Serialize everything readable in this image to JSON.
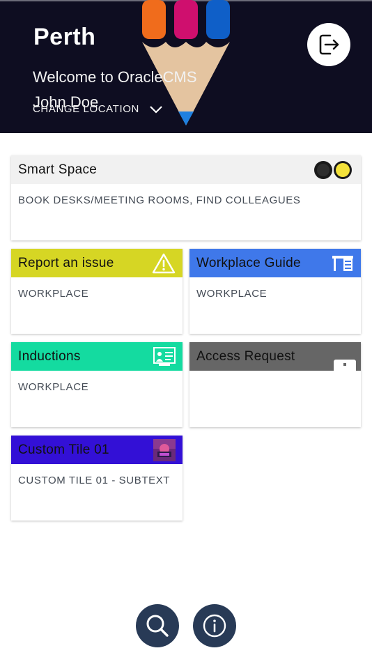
{
  "header": {
    "city": "Perth",
    "welcome": "Welcome to OracleCMS",
    "user": "John Doe",
    "change_location": "CHANGE LOCATION"
  },
  "tiles": [
    {
      "title": "Smart Space",
      "subtitle": "BOOK DESKS/MEETING ROOMS, FIND COLLEAGUES",
      "color": "#f1f1f1",
      "icon": "toggle-icon"
    },
    {
      "title": "Report an issue",
      "subtitle": "WORKPLACE",
      "color": "#d6d624",
      "icon": "warning-icon"
    },
    {
      "title": "Workplace Guide",
      "subtitle": "WORKPLACE",
      "color": "#3f78ea",
      "icon": "desk-icon"
    },
    {
      "title": "Inductions",
      "subtitle": "WORKPLACE",
      "color": "#14dba0",
      "icon": "presentation-icon"
    },
    {
      "title": "Access Request",
      "subtitle": "",
      "color": "#666666",
      "icon": "badge-icon"
    },
    {
      "title": "Custom Tile 01",
      "subtitle": "CUSTOM TILE 01 - SUBTEXT",
      "color": "#3310d6",
      "icon": "image-thumbnail-icon"
    }
  ],
  "colors": {
    "header_bg": "#0e0d21",
    "bottom_button": "#283a56"
  }
}
